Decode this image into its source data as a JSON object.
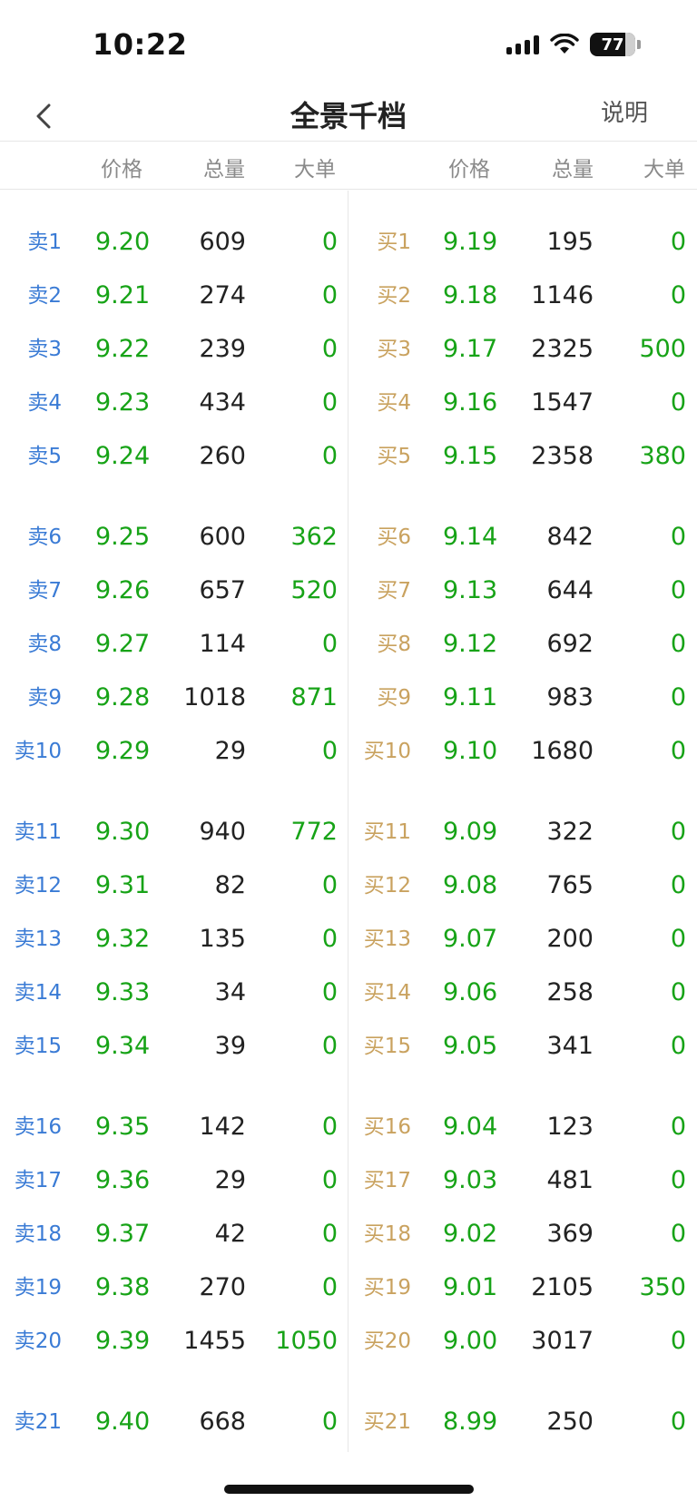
{
  "status": {
    "time": "10:22",
    "battery": "77"
  },
  "nav": {
    "title": "全景千档",
    "help": "说明"
  },
  "headers": {
    "price": "价格",
    "total": "总量",
    "big": "大单"
  },
  "sell_rows": [
    {
      "label": "卖1",
      "price": "9.20",
      "total": "609",
      "big": "0"
    },
    {
      "label": "卖2",
      "price": "9.21",
      "total": "274",
      "big": "0"
    },
    {
      "label": "卖3",
      "price": "9.22",
      "total": "239",
      "big": "0"
    },
    {
      "label": "卖4",
      "price": "9.23",
      "total": "434",
      "big": "0"
    },
    {
      "label": "卖5",
      "price": "9.24",
      "total": "260",
      "big": "0"
    },
    {
      "label": "卖6",
      "price": "9.25",
      "total": "600",
      "big": "362"
    },
    {
      "label": "卖7",
      "price": "9.26",
      "total": "657",
      "big": "520"
    },
    {
      "label": "卖8",
      "price": "9.27",
      "total": "114",
      "big": "0"
    },
    {
      "label": "卖9",
      "price": "9.28",
      "total": "1018",
      "big": "871"
    },
    {
      "label": "卖10",
      "price": "9.29",
      "total": "29",
      "big": "0"
    },
    {
      "label": "卖11",
      "price": "9.30",
      "total": "940",
      "big": "772"
    },
    {
      "label": "卖12",
      "price": "9.31",
      "total": "82",
      "big": "0"
    },
    {
      "label": "卖13",
      "price": "9.32",
      "total": "135",
      "big": "0"
    },
    {
      "label": "卖14",
      "price": "9.33",
      "total": "34",
      "big": "0"
    },
    {
      "label": "卖15",
      "price": "9.34",
      "total": "39",
      "big": "0"
    },
    {
      "label": "卖16",
      "price": "9.35",
      "total": "142",
      "big": "0"
    },
    {
      "label": "卖17",
      "price": "9.36",
      "total": "29",
      "big": "0"
    },
    {
      "label": "卖18",
      "price": "9.37",
      "total": "42",
      "big": "0"
    },
    {
      "label": "卖19",
      "price": "9.38",
      "total": "270",
      "big": "0"
    },
    {
      "label": "卖20",
      "price": "9.39",
      "total": "1455",
      "big": "1050"
    },
    {
      "label": "卖21",
      "price": "9.40",
      "total": "668",
      "big": "0"
    }
  ],
  "buy_rows": [
    {
      "label": "买1",
      "price": "9.19",
      "total": "195",
      "big": "0"
    },
    {
      "label": "买2",
      "price": "9.18",
      "total": "1146",
      "big": "0"
    },
    {
      "label": "买3",
      "price": "9.17",
      "total": "2325",
      "big": "500"
    },
    {
      "label": "买4",
      "price": "9.16",
      "total": "1547",
      "big": "0"
    },
    {
      "label": "买5",
      "price": "9.15",
      "total": "2358",
      "big": "380"
    },
    {
      "label": "买6",
      "price": "9.14",
      "total": "842",
      "big": "0"
    },
    {
      "label": "买7",
      "price": "9.13",
      "total": "644",
      "big": "0"
    },
    {
      "label": "买8",
      "price": "9.12",
      "total": "692",
      "big": "0"
    },
    {
      "label": "买9",
      "price": "9.11",
      "total": "983",
      "big": "0"
    },
    {
      "label": "买10",
      "price": "9.10",
      "total": "1680",
      "big": "0"
    },
    {
      "label": "买11",
      "price": "9.09",
      "total": "322",
      "big": "0"
    },
    {
      "label": "买12",
      "price": "9.08",
      "total": "765",
      "big": "0"
    },
    {
      "label": "买13",
      "price": "9.07",
      "total": "200",
      "big": "0"
    },
    {
      "label": "买14",
      "price": "9.06",
      "total": "258",
      "big": "0"
    },
    {
      "label": "买15",
      "price": "9.05",
      "total": "341",
      "big": "0"
    },
    {
      "label": "买16",
      "price": "9.04",
      "total": "123",
      "big": "0"
    },
    {
      "label": "买17",
      "price": "9.03",
      "total": "481",
      "big": "0"
    },
    {
      "label": "买18",
      "price": "9.02",
      "total": "369",
      "big": "0"
    },
    {
      "label": "买19",
      "price": "9.01",
      "total": "2105",
      "big": "350"
    },
    {
      "label": "买20",
      "price": "9.00",
      "total": "3017",
      "big": "0"
    },
    {
      "label": "买21",
      "price": "8.99",
      "total": "250",
      "big": "0"
    }
  ],
  "colors": {
    "price_green": "#17a317",
    "sell_label": "#3a7bd5",
    "buy_label": "#c9a25f"
  }
}
